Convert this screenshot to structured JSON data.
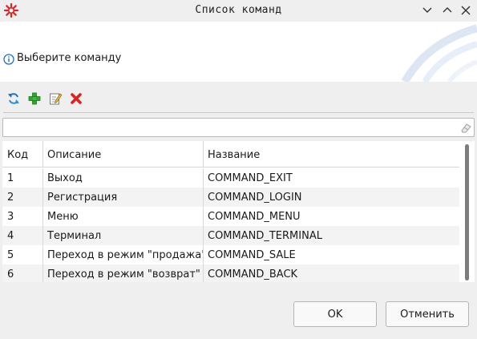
{
  "window": {
    "title": "Список команд",
    "controls": [
      "chevron-down-icon",
      "chevron-up-icon",
      "close-icon"
    ]
  },
  "header": {
    "text": "Выберите команду",
    "icon": "info-icon"
  },
  "toolbar": {
    "buttons": [
      "refresh-icon",
      "add-icon",
      "edit-icon",
      "delete-icon"
    ]
  },
  "search": {
    "value": "",
    "placeholder": ""
  },
  "table": {
    "columns": [
      "Код",
      "Описание",
      "Название"
    ],
    "rows": [
      [
        "1",
        "Выход",
        "COMMAND_EXIT"
      ],
      [
        "2",
        "Регистрация",
        "COMMAND_LOGIN"
      ],
      [
        "3",
        "Меню",
        "COMMAND_MENU"
      ],
      [
        "4",
        "Терминал",
        "COMMAND_TERMINAL"
      ],
      [
        "5",
        "Переход в режим \"продажа\"",
        "COMMAND_SALE"
      ],
      [
        "6",
        "Переход в режим \"возврат\"",
        "COMMAND_BACK"
      ]
    ]
  },
  "buttons": {
    "ok": "OK",
    "cancel": "Отменить"
  },
  "colors": {
    "accent": "#1e6fc7",
    "add": "#2fa52f",
    "delete": "#e02020",
    "app_icon": "#d9262b"
  }
}
